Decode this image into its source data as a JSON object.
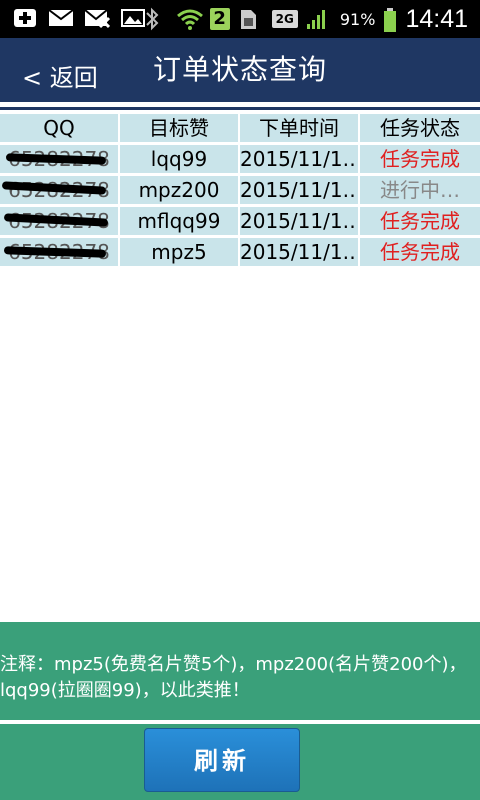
{
  "status_bar": {
    "battery": "91%",
    "clock": "14:41",
    "sim_badge": "2",
    "network": "2G",
    "icons": [
      "add-icon",
      "mail-icon",
      "mail-crossed-icon",
      "image-icon",
      "bluetooth-icon",
      "wifi-icon",
      "sim-icon",
      "signal-icon",
      "battery-icon"
    ]
  },
  "header": {
    "back_label": "< 返回",
    "title": "订单状态查询"
  },
  "table": {
    "columns": [
      "QQ",
      "目标赞",
      "下单时间",
      "任务状态"
    ],
    "rows": [
      {
        "qq": "65282278",
        "target": "lqq99",
        "time": "2015/11/1…",
        "status": "任务完成",
        "status_type": "done"
      },
      {
        "qq": "65282278",
        "target": "mpz200",
        "time": "2015/11/1…",
        "status": "进行中…",
        "status_type": "progress"
      },
      {
        "qq": "65282278",
        "target": "mflqq99",
        "time": "2015/11/1…",
        "status": "任务完成",
        "status_type": "done"
      },
      {
        "qq": "65282278",
        "target": "mpz5",
        "time": "2015/11/1…",
        "status": "任务完成",
        "status_type": "done"
      }
    ]
  },
  "footer": {
    "note": "注释：mpz5(免费名片赞5个)，mpz200(名片赞200个)，lqq99(拉圈圈99)，以此类推！",
    "refresh_label": "刷新"
  },
  "colors": {
    "header_bg": "#1f3763",
    "cell_bg": "#c9e4ea",
    "done": "#e02020",
    "progress": "#888888",
    "footer_bg": "#3aa07a",
    "button_bg": "#2283cc"
  }
}
